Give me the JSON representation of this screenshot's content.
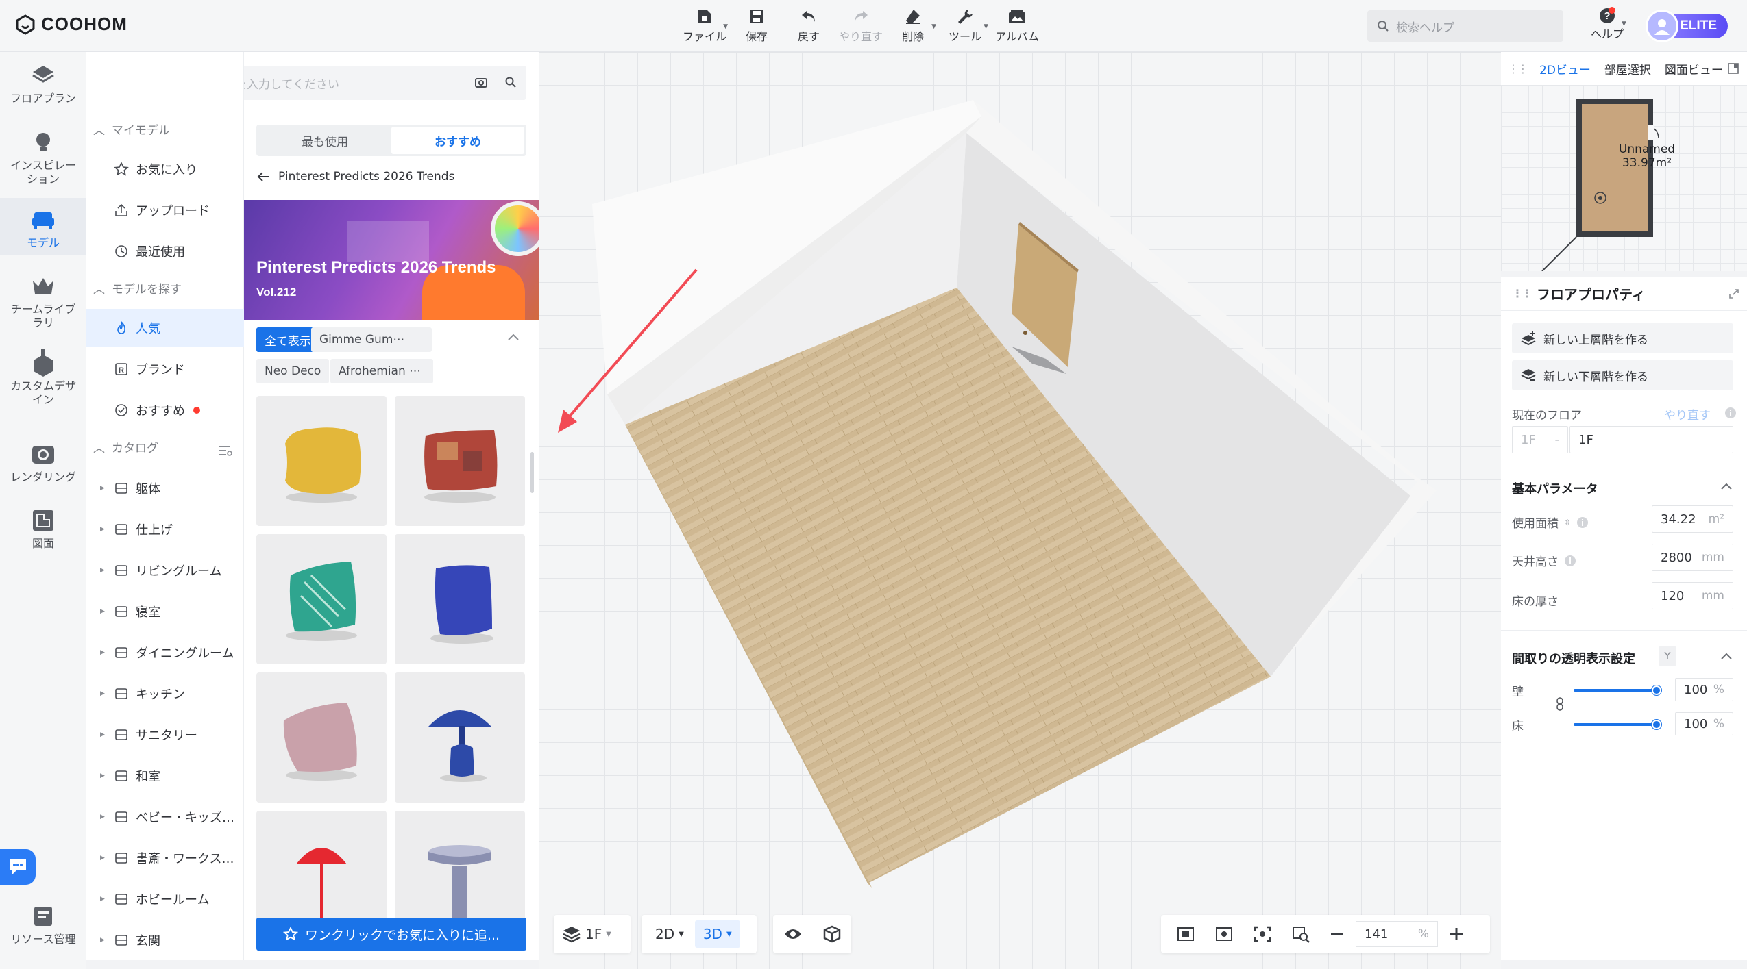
{
  "app": {
    "brand": "COOHOM"
  },
  "toolbar": {
    "items": [
      {
        "label": "ファイル",
        "icon": "file-icon",
        "caret": true,
        "enabled": true
      },
      {
        "label": "保存",
        "icon": "save-icon",
        "caret": false,
        "enabled": true
      },
      {
        "label": "戻す",
        "icon": "undo-icon",
        "caret": false,
        "enabled": true
      },
      {
        "label": "やり直す",
        "icon": "redo-icon",
        "caret": false,
        "enabled": false
      },
      {
        "label": "削除",
        "icon": "eraser-icon",
        "caret": true,
        "enabled": true
      },
      {
        "label": "ツール",
        "icon": "wrench-icon",
        "caret": true,
        "enabled": true
      },
      {
        "label": "アルバム",
        "icon": "album-icon",
        "caret": false,
        "enabled": true
      }
    ],
    "help_search_placeholder": "検索ヘルプ",
    "help_label": "ヘルプ",
    "elite_badge": "ELITE"
  },
  "rail": {
    "items": [
      {
        "label": "フロアプラン",
        "icon": "floorplan-icon"
      },
      {
        "label": "インスピレーション",
        "icon": "lightbulb-icon"
      },
      {
        "label": "モデル",
        "icon": "sofa-icon",
        "active": true
      },
      {
        "label": "チームライブラリ",
        "icon": "crown-icon"
      },
      {
        "label": "カスタムデザイン",
        "icon": "custom-design-icon"
      },
      {
        "label": "レンダリング",
        "icon": "camera-icon"
      },
      {
        "label": "図面",
        "icon": "drawing-icon"
      }
    ],
    "bottom_label": "リソース管理"
  },
  "search": {
    "placeholder": "キーワードを入力してください"
  },
  "sidebar": {
    "my_models_title": "マイモデル",
    "my_models": [
      {
        "label": "お気に入り",
        "icon": "star-icon"
      },
      {
        "label": "アップロード",
        "icon": "upload-icon"
      },
      {
        "label": "最近使用",
        "icon": "clock-icon"
      }
    ],
    "find_title": "モデルを探す",
    "find_items": [
      {
        "label": "人気",
        "icon": "flame-icon",
        "active": true
      },
      {
        "label": "ブランド",
        "icon": "brand-icon"
      },
      {
        "label": "おすすめ",
        "icon": "check-circle-icon",
        "dot": true
      }
    ],
    "catalog_title": "カタログ",
    "catalog": [
      "躯体",
      "仕上げ",
      "リビングルーム",
      "寝室",
      "ダイニングルーム",
      "キッチン",
      "サニタリー",
      "和室",
      "ベビー・キッズ…",
      "書斎・ワークス…",
      "ホビールーム",
      "玄関"
    ]
  },
  "models": {
    "tabs": [
      "最も使用",
      "おすすめ"
    ],
    "active_tab": 1,
    "breadcrumb": "Pinterest Predicts 2026 Trends",
    "banner_title": "Pinterest Predicts 2026 Trends",
    "banner_vol": "Vol.212",
    "tags": [
      "全て表示",
      "Gimme Gum⋯",
      "Neo Deco",
      "Afrohemian ⋯"
    ],
    "cards": [
      {
        "name": "yellow-pillow",
        "color": "#e3b73a"
      },
      {
        "name": "patchwork-pillow",
        "color": "#b0463a"
      },
      {
        "name": "leaf-pillow",
        "color": "#2fa58f"
      },
      {
        "name": "blue-bean-bag",
        "color": "#3646b8"
      },
      {
        "name": "pink-pillow",
        "color": "#c9a1aa"
      },
      {
        "name": "blue-mushroom-lamp",
        "color": "#2d4aa8"
      },
      {
        "name": "red-floor-lamp",
        "color": "#e52830"
      },
      {
        "name": "grey-side-table",
        "color": "#8a8fb0"
      }
    ],
    "fav_button": "ワンクリックでお気に入りに追..."
  },
  "bottom": {
    "floor": "1F",
    "view_2d": "2D",
    "view_3d": "3D",
    "zoom": "141",
    "zoom_unit": "%"
  },
  "right": {
    "tabs": [
      "2Dビュー",
      "部屋選択",
      "図面ビュー"
    ],
    "room_name": "Unnamed",
    "room_area": "33.97m²",
    "floor_props_title": "フロアプロパティ",
    "btn_upper": "新しい上層階を作る",
    "btn_lower": "新しい下層階を作る",
    "current_floor_label": "現在のフロア",
    "redo_link": "やり直す",
    "floor_prefix": "1F",
    "floor_value": "1F",
    "basic_params": "基本パラメータ",
    "area_label": "使用面積",
    "area_value": "34.22",
    "area_unit": "m²",
    "ceiling_label": "天井高さ",
    "ceiling_value": "2800",
    "ceiling_unit": "mm",
    "thickness_label": "床の厚さ",
    "thickness_value": "120",
    "thickness_unit": "mm",
    "transparency_title": "間取りの透明表示設定",
    "transparency_key": "Y",
    "wall_label": "壁",
    "wall_value": "100",
    "floor_label": "床",
    "floor_opacity": "100",
    "percent": "%",
    "accent": "#1a73e8"
  }
}
